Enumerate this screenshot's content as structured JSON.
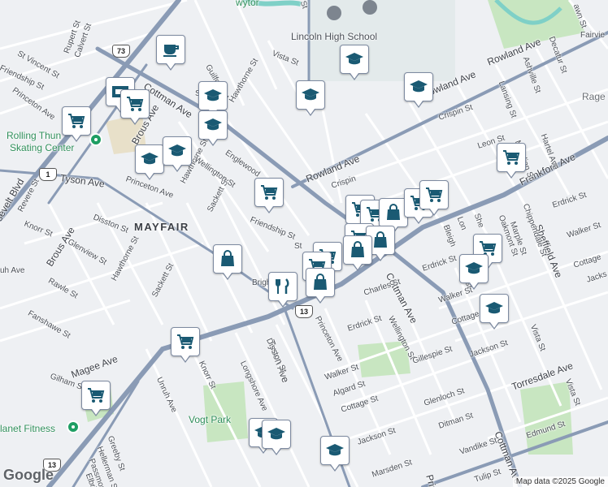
{
  "map": {
    "attribution": "Map data ©2025 Google",
    "logo": "Google"
  },
  "areas": {
    "neighborhood": "MAYFAIR"
  },
  "places": {
    "lincoln_high": "Lincoln High School",
    "rolling_thunder_1": "Rolling Thun",
    "rolling_thunder_2": "Skating Center",
    "planet_fitness": "lanet Fitness",
    "vogt_park": "Vogt Park",
    "rage": "Rage",
    "top_partial": "wytor"
  },
  "streets": {
    "cottman_ave_1": "Cottman Ave",
    "cottman_ave_2": "Cottman Ave",
    "cottman_ave_3": "Cottman Ave",
    "frankford_ave": "Frankford Ave",
    "rowland_ave_1": "Rowland Ave",
    "rowland_ave_2": "Rowland Ave",
    "rowland_ave_3": "Rowland Ave",
    "tyson_ave_1": "Tyson Ave",
    "tyson_ave_2": "Tyson Ave",
    "torresdale_ave": "Torresdale Ave",
    "brous_ave_1": "Brous Ave",
    "brous_ave_2": "Brous Ave",
    "roosevelt_blvd": "osevelt Blvd",
    "sheffield_ave": "Sheffield Ave",
    "princeton_ave_1": "Princeton Ave",
    "princeton_ave_2": "Princeton Ave",
    "princeton_ave_3": "Princeton Ave",
    "princeton_ave_4": "Princ",
    "longshore_ave": "Longshore Ave",
    "unruh_ave": "Unruh Ave",
    "magee_ave": "Magee Ave",
    "disston_st_1": "Disston St",
    "disston_st_2": "Disston St",
    "hawthorne_st_1": "Hawthorne St",
    "hawthorne_st_2": "Hawthorne St",
    "hawthorne_st_3": "Hawthorne St",
    "sackett_st_1": "Sackett St",
    "sackett_st_2": "Sackett St",
    "knorr_st_1": "Knorr St",
    "knorr_st_2": "Knorr St",
    "friendship_st_1": "Friendship St",
    "friendship_st_2": "Friendship St",
    "wellington_st_1": "Wellington St",
    "wellington_st_2": "Wellington St",
    "englewood": "Englewood",
    "guilford_st": "Guilford St",
    "vista_st_1": "Vista St",
    "vista_st_2": "Vista St",
    "vista_st_3": "Vista St",
    "crispin_st_1": "Crispin St",
    "crispin_st_2": "Crispin",
    "leon_st": "Leon St",
    "lansing_st": "Lansing St",
    "ashville_st": "Ashville St",
    "decatur_st": "Decatur St",
    "hartel_ave": "Hartel Ave",
    "fairview": "Fairvie",
    "erdrick_st_1": "Erdrick St",
    "erdrick_st_2": "Erdrick St",
    "erdrick_st_3": "Erdrick St",
    "walker_st_1": "Walker St",
    "walker_st_2": "Walker St",
    "walker_st_3": "Walker St",
    "cottage_st_1": "Cottage St",
    "cottage_st_2": "Cottage St",
    "cottage_st_3": "Cottage",
    "jackson_st_1": "Jackson St",
    "jackson_st_2": "Jackson St",
    "jackson_st_3": "Jacks",
    "charles_st": "Charles St",
    "algard_st": "Algard St",
    "gillespie_st": "Gillespie St",
    "glenloch_st": "Glenloch St",
    "ditman_st": "Ditman St",
    "vandike_st": "Vandike St",
    "edmund_st": "Edmund St",
    "marsden_st": "Marsden St",
    "oakmont_st": "Oakmont St",
    "marple_st": "Marple St",
    "chippendale_st": "Chippendale St",
    "bleigh": "Bleigh",
    "lon": "Lon",
    "she": "She",
    "vist": "Vist",
    "meridian_st": "Meridian St",
    "tulip": "Tulip St",
    "st_vincent_st": "St Vincent St",
    "rupert_st": "Rupert St",
    "calvert_st": "Calvert St",
    "friendship_w": "Friendship St",
    "princeton_w": "Princeton Ave",
    "revere_st": "Revere St",
    "knorr_w": "Knorr St",
    "glenview_st": "Glenview St",
    "rawle_st": "Rawle St",
    "fanshawe_st": "Fanshawe St",
    "gilham_st": "Gilham St",
    "greeby_st": "Greeby St",
    "hellerman_st": "Hellerman St",
    "passmore_st": "Passmore St",
    "elbridge": "Elbrid",
    "brigh": "Brigh",
    "st_a": "St",
    "st_b": "St",
    "st_c": "St",
    "ave_w": "Ave",
    "ruh": "uh Ave",
    "tyson_w": "Tyson Ave",
    "dawn": "awn St",
    "cri_top": "Cris",
    "marsden_e": "Marsden"
  },
  "shields": {
    "us13_top": "73",
    "us13_a": "13",
    "us13_b": "13",
    "us1": "1"
  },
  "icons": {
    "school": "school-cap-icon",
    "grocery": "shopping-cart-icon",
    "shop": "shopping-bag-icon",
    "cafe": "coffee-cup-icon",
    "restaurant": "fork-knife-icon",
    "atm": "atm-icon"
  },
  "colors": {
    "marker_fill": "#1a5a73",
    "road_main": "#8a9bb5",
    "road_minor": "#ffffff",
    "park": "#c8e6c1",
    "water": "#7fd0c7"
  }
}
